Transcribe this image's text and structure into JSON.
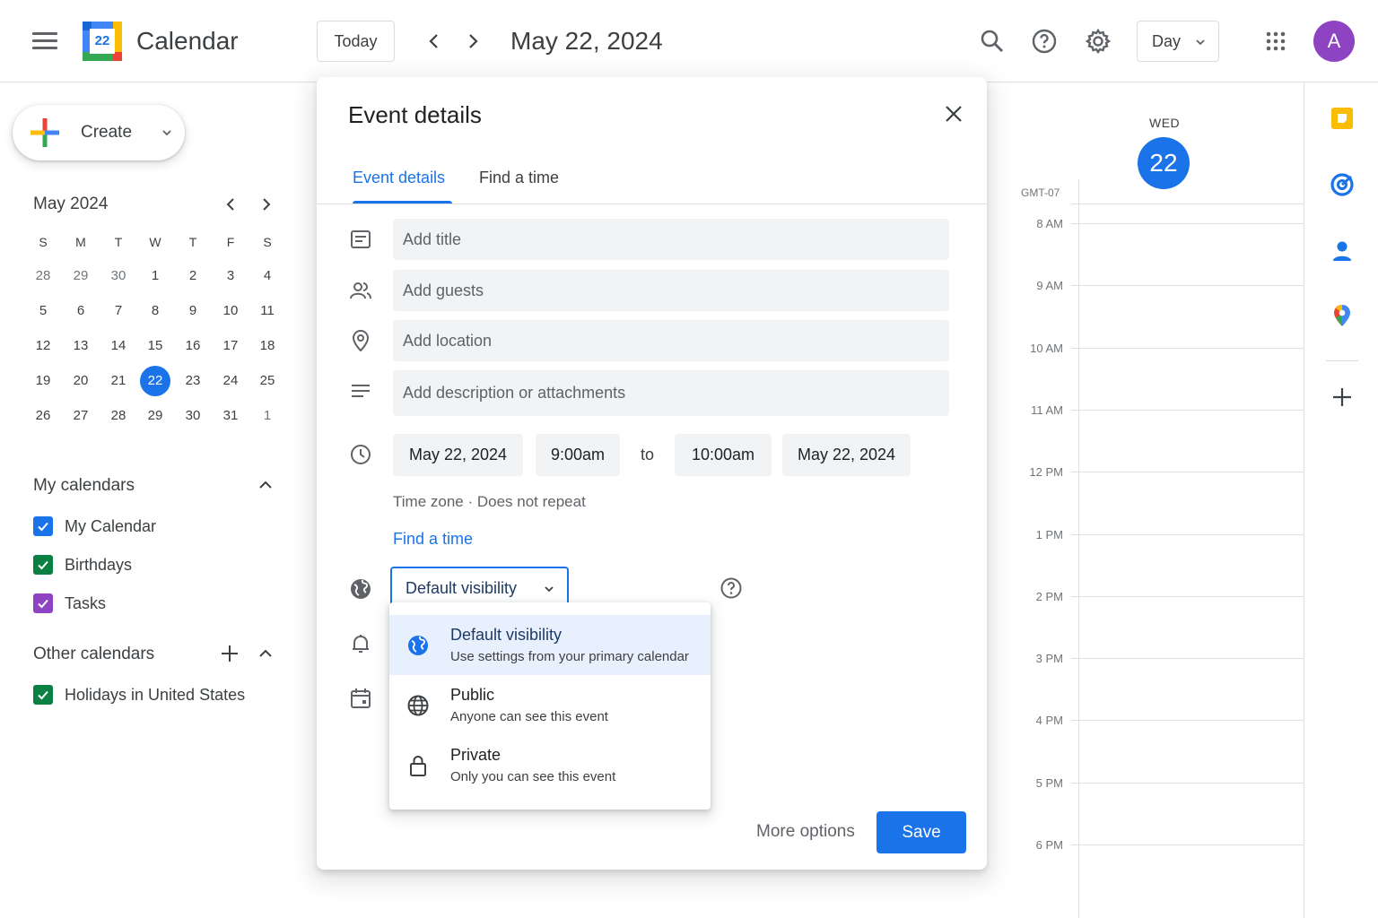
{
  "header": {
    "app_title": "Calendar",
    "logo_day": "22",
    "today_label": "Today",
    "current_date": "May 22, 2024",
    "view_label": "Day",
    "avatar_initial": "A"
  },
  "sidebar": {
    "create_label": "Create",
    "mini_calendar": {
      "title": "May 2024",
      "weekdays": [
        "S",
        "M",
        "T",
        "W",
        "T",
        "F",
        "S"
      ],
      "weeks": [
        [
          "28",
          "29",
          "30",
          "1",
          "2",
          "3",
          "4"
        ],
        [
          "5",
          "6",
          "7",
          "8",
          "9",
          "10",
          "11"
        ],
        [
          "12",
          "13",
          "14",
          "15",
          "16",
          "17",
          "18"
        ],
        [
          "19",
          "20",
          "21",
          "22",
          "23",
          "24",
          "25"
        ],
        [
          "26",
          "27",
          "28",
          "29",
          "30",
          "31",
          "1"
        ]
      ],
      "selected": "22"
    },
    "my_calendars": {
      "title": "My calendars",
      "items": [
        {
          "name": "My Calendar",
          "color": "#1a73e8"
        },
        {
          "name": "Birthdays",
          "color": "#0b8043"
        },
        {
          "name": "Tasks",
          "color": "#8e44c2"
        }
      ]
    },
    "other_calendars": {
      "title": "Other calendars",
      "items": [
        {
          "name": "Holidays in United States",
          "color": "#0b8043"
        }
      ]
    }
  },
  "day_view": {
    "weekday": "WED",
    "day_number": "22",
    "timezone": "GMT-07",
    "hours": [
      "8 AM",
      "9 AM",
      "10 AM",
      "11 AM",
      "12 PM",
      "1 PM",
      "2 PM",
      "3 PM",
      "4 PM",
      "5 PM",
      "6 PM"
    ]
  },
  "dialog": {
    "title": "Event details",
    "tabs": [
      "Event details",
      "Find a time"
    ],
    "title_placeholder": "Add title",
    "guests_placeholder": "Add guests",
    "location_placeholder": "Add location",
    "description_placeholder": "Add description or attachments",
    "start_date": "May 22, 2024",
    "start_time": "9:00am",
    "to_label": "to",
    "end_time": "10:00am",
    "end_date": "May 22, 2024",
    "timezone_line": "Time zone · Does not repeat",
    "find_a_time": "Find a time",
    "visibility_value": "Default visibility",
    "more_options": "More options",
    "save_label": "Save"
  },
  "visibility_menu": {
    "options": [
      {
        "title": "Default visibility",
        "subtitle": "Use settings from your primary calendar",
        "icon": "globe-filled-icon",
        "selected": true
      },
      {
        "title": "Public",
        "subtitle": "Anyone can see this event",
        "icon": "globe-icon",
        "selected": false
      },
      {
        "title": "Private",
        "subtitle": "Only you can see this event",
        "icon": "lock-icon",
        "selected": false
      }
    ]
  },
  "colors": {
    "accent": "#1a73e8",
    "avatar": "#8e44c2"
  }
}
